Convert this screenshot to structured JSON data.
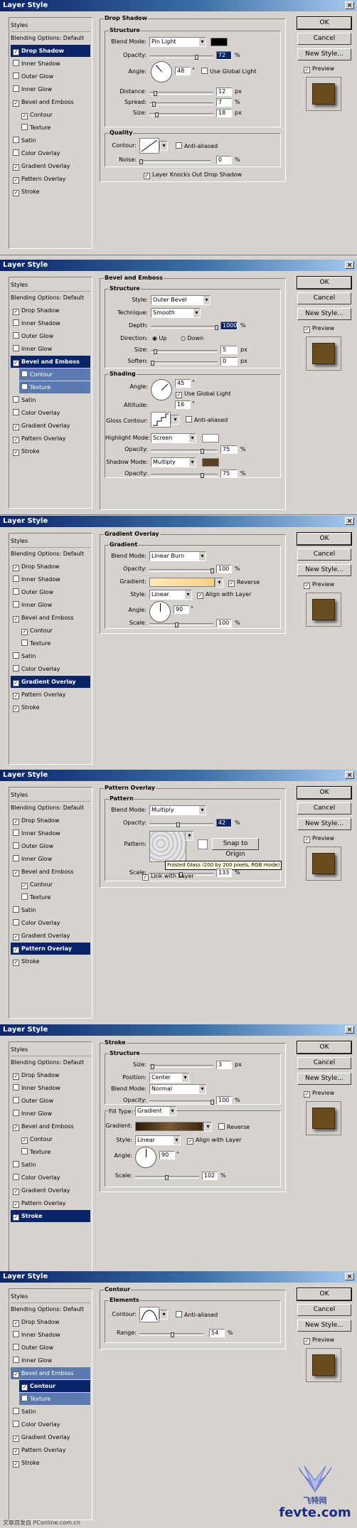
{
  "dialog_title": "Layer Style",
  "close_glyph": "×",
  "buttons": {
    "ok": "OK",
    "cancel": "Cancel",
    "new_style": "New Style...",
    "preview": "Preview"
  },
  "style_list": [
    "Styles",
    "Blending Options: Default",
    "Drop Shadow",
    "Inner Shadow",
    "Outer Glow",
    "Inner Glow",
    "Bevel and Emboss",
    "Contour",
    "Texture",
    "Satin",
    "Color Overlay",
    "Gradient Overlay",
    "Pattern Overlay",
    "Stroke"
  ],
  "checked": {
    "drop_shadow": true,
    "inner_shadow": false,
    "outer_glow": false,
    "inner_glow": false,
    "bevel": true,
    "contour": true,
    "texture": false,
    "satin": false,
    "color_overlay": false,
    "gradient_overlay": true,
    "pattern_overlay": true,
    "stroke": true
  },
  "panel1": {
    "title": "Drop Shadow",
    "group": "Structure",
    "blend_mode_label": "Blend Mode:",
    "blend_mode": "Pin Light",
    "blend_color": "#000000",
    "opacity_label": "Opacity:",
    "opacity": "72",
    "opacity_unit": "%",
    "angle_label": "Angle:",
    "angle": "48",
    "angle_unit": "°",
    "global_light": "Use Global Light",
    "distance_label": "Distance:",
    "distance": "12",
    "spread_label": "Spread:",
    "spread": "7",
    "size_label": "Size:",
    "size": "18",
    "px": "px",
    "pct": "%",
    "quality": "Quality",
    "contour_label": "Contour:",
    "anti_aliased": "Anti-aliased",
    "noise_label": "Noise:",
    "noise": "0",
    "knocks_out": "Layer Knocks Out Drop Shadow"
  },
  "panel2": {
    "title": "Bevel and Emboss",
    "group": "Structure",
    "style_label": "Style:",
    "style": "Outer Bevel",
    "technique_label": "Technique:",
    "technique": "Smooth",
    "depth_label": "Depth:",
    "depth": "1000",
    "direction_label": "Direction:",
    "up": "Up",
    "down": "Down",
    "size_label": "Size:",
    "size": "5",
    "soften_label": "Soften:",
    "soften": "0",
    "shading": "Shading",
    "angle_label": "Angle:",
    "angle": "45",
    "global_light": "Use Global Light",
    "altitude_label": "Altitude:",
    "altitude": "16",
    "gloss_label": "Gloss Contour:",
    "anti_aliased": "Anti-aliased",
    "highlight_label": "Highlight Mode:",
    "highlight": "Screen",
    "highlight_color": "#ffffff",
    "h_opacity_label": "Opacity:",
    "h_opacity": "75",
    "shadow_label": "Shadow Mode:",
    "shadow": "Multiply",
    "shadow_color": "#5a4020",
    "s_opacity_label": "Opacity:",
    "s_opacity": "75",
    "px": "px",
    "pct": "%",
    "deg": "°"
  },
  "panel3": {
    "title": "Gradient Overlay",
    "group": "Gradient",
    "blend_mode_label": "Blend Mode:",
    "blend_mode": "Linear Burn",
    "opacity_label": "Opacity:",
    "opacity": "100",
    "gradient_label": "Gradient:",
    "reverse": "Reverse",
    "style_label": "Style:",
    "style": "Linear",
    "align": "Align with Layer",
    "angle_label": "Angle:",
    "angle": "90",
    "scale_label": "Scale:",
    "scale": "100",
    "pct": "%",
    "deg": "°"
  },
  "panel4": {
    "title": "Pattern Overlay",
    "group": "Pattern",
    "blend_mode_label": "Blend Mode:",
    "blend_mode": "Multiply",
    "opacity_label": "Opacity:",
    "opacity": "42",
    "pattern_label": "Pattern:",
    "snap": "Snap to Origin",
    "tooltip": "Frosted Glass (200 by 200 pixels, RGB mode)",
    "scale_label": "Scale:",
    "scale": "133",
    "link": "Link with Layer",
    "pct": "%"
  },
  "panel5": {
    "title": "Stroke",
    "group": "Structure",
    "size_label": "Size:",
    "size": "3",
    "position_label": "Position:",
    "position": "Center",
    "blend_mode_label": "Blend Mode:",
    "blend_mode": "Normal",
    "opacity_label": "Opacity:",
    "opacity": "100",
    "fill_type_label": "Fill Type:",
    "fill_type": "Gradient",
    "gradient_label": "Gradient:",
    "reverse": "Reverse",
    "style_label": "Style:",
    "style": "Linear",
    "align": "Align with Layer",
    "angle_label": "Angle:",
    "angle": "90",
    "scale_label": "Scale:",
    "scale": "102",
    "px": "px",
    "pct": "%",
    "deg": "°"
  },
  "panel6": {
    "title": "Contour",
    "group": "Elements",
    "contour_label": "Contour:",
    "anti_aliased": "Anti-aliased",
    "range_label": "Range:",
    "range": "54",
    "pct": "%"
  },
  "watermark": {
    "site": "fevte.com",
    "cn": "飞特网",
    "bottom_left": "文章首发自 PConline.com.cn"
  },
  "colors": {
    "selection": "#0a246a",
    "titlebar": "#0a246a",
    "face": "#d6d3ce"
  }
}
